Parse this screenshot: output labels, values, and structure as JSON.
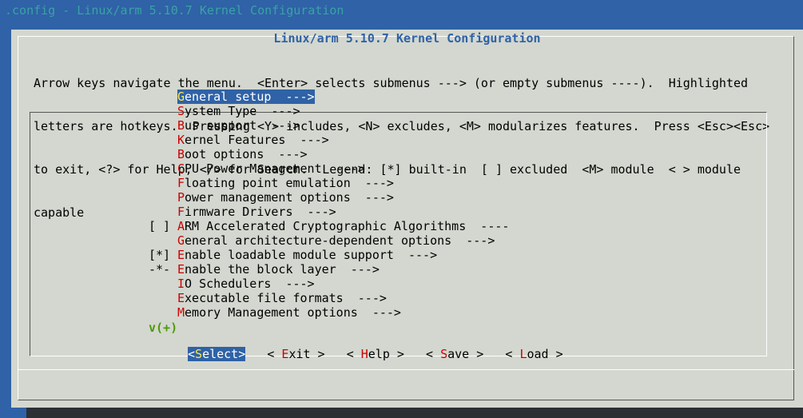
{
  "terminal": {
    "title": ".config - Linux/arm 5.10.7 Kernel Configuration"
  },
  "dialog": {
    "title": "Linux/arm 5.10.7 Kernel Configuration",
    "help_lines": [
      "Arrow keys navigate the menu.  <Enter> selects submenus ---> (or empty submenus ----).  Highlighted",
      "letters are hotkeys.  Pressing <Y> includes, <N> excludes, <M> modularizes features.  Press <Esc><Esc>",
      "to exit, <?> for Help, </> for Search.  Legend: [*] built-in  [ ] excluded  <M> module  < > module",
      "capable"
    ]
  },
  "menu": {
    "items": [
      {
        "prefix": "",
        "hotkey": "G",
        "rest": "eneral setup  --->",
        "selected": true
      },
      {
        "prefix": "",
        "hotkey": "S",
        "rest": "ystem Type  --->"
      },
      {
        "prefix": "",
        "hotkey": "B",
        "rest": "us support  --->"
      },
      {
        "prefix": "",
        "hotkey": "K",
        "rest": "ernel Features  --->"
      },
      {
        "prefix": "",
        "hotkey": "B",
        "rest": "oot options  --->"
      },
      {
        "prefix": "",
        "hotkey": "C",
        "rest": "PU Power Management  --->"
      },
      {
        "prefix": "",
        "hotkey": "F",
        "rest": "loating point emulation  --->"
      },
      {
        "prefix": "",
        "hotkey": "P",
        "rest": "ower management options  --->"
      },
      {
        "prefix": "",
        "hotkey": "F",
        "rest": "irmware Drivers  --->"
      },
      {
        "prefix": "[ ] ",
        "hotkey": "A",
        "rest": "RM Accelerated Cryptographic Algorithms  ----"
      },
      {
        "prefix": "",
        "hotkey": "G",
        "rest": "eneral architecture-dependent options  --->"
      },
      {
        "prefix": "[*] ",
        "hotkey": "E",
        "rest": "nable loadable module support  --->"
      },
      {
        "prefix": "-*- ",
        "hotkey": "E",
        "rest": "nable the block layer  --->"
      },
      {
        "prefix": "",
        "hotkey": "I",
        "rest": "O Schedulers  --->"
      },
      {
        "prefix": "",
        "hotkey": "E",
        "rest": "xecutable file formats  --->"
      },
      {
        "prefix": "",
        "hotkey": "M",
        "rest": "emory Management options  --->",
        "hotkey_index": 1
      }
    ],
    "more_indicator": "v(+)"
  },
  "buttons": [
    {
      "pre": "<",
      "hotkey": "S",
      "post": "elect>",
      "active": true
    },
    {
      "pre": "< ",
      "hotkey": "E",
      "post": "xit >"
    },
    {
      "pre": "< ",
      "hotkey": "H",
      "post": "elp >"
    },
    {
      "pre": "< ",
      "hotkey": "S",
      "post": "ave >"
    },
    {
      "pre": "< ",
      "hotkey": "L",
      "post": "oad >"
    }
  ],
  "colors": {
    "background": "#2f62a6",
    "dialog": "#d3d7cf",
    "title": "#2f62a6",
    "hotkey": "#cc0000",
    "hotkey_selected": "#fce94f",
    "more": "#4e9a06"
  }
}
